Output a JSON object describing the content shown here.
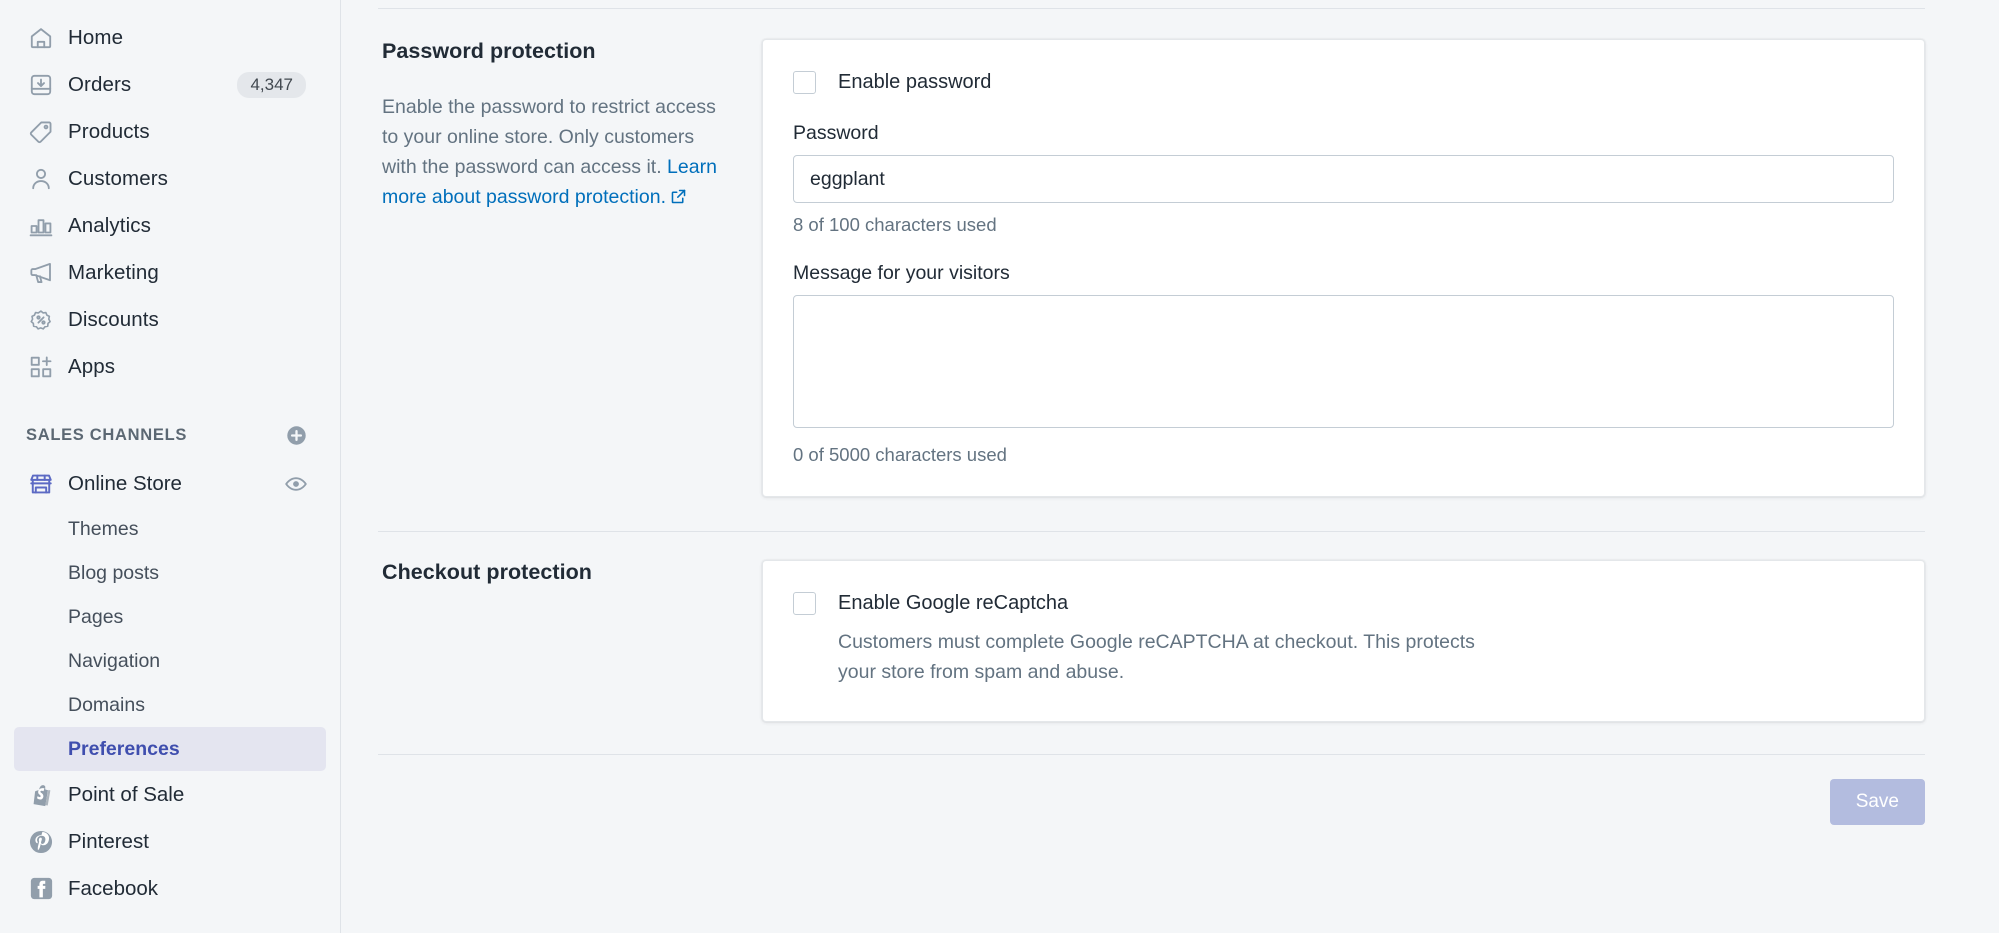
{
  "sidebar": {
    "nav": [
      {
        "label": "Home",
        "icon": "home-icon",
        "badge": null
      },
      {
        "label": "Orders",
        "icon": "orders-icon",
        "badge": "4,347"
      },
      {
        "label": "Products",
        "icon": "products-tag-icon",
        "badge": null
      },
      {
        "label": "Customers",
        "icon": "customers-person-icon",
        "badge": null
      },
      {
        "label": "Analytics",
        "icon": "analytics-bar-chart-icon",
        "badge": null
      },
      {
        "label": "Marketing",
        "icon": "marketing-megaphone-icon",
        "badge": null
      },
      {
        "label": "Discounts",
        "icon": "discounts-percent-icon",
        "badge": null
      },
      {
        "label": "Apps",
        "icon": "apps-grid-plus-icon",
        "badge": null
      }
    ],
    "sales_channels": {
      "title": "SALES CHANNELS",
      "add_icon": "plus-circle-icon",
      "online_store": {
        "label": "Online Store",
        "icon": "storefront-icon",
        "view_icon": "eye-icon"
      },
      "sub_items": [
        {
          "label": "Themes",
          "active": false
        },
        {
          "label": "Blog posts",
          "active": false
        },
        {
          "label": "Pages",
          "active": false
        },
        {
          "label": "Navigation",
          "active": false
        },
        {
          "label": "Domains",
          "active": false
        },
        {
          "label": "Preferences",
          "active": true
        }
      ],
      "channels": [
        {
          "label": "Point of Sale",
          "icon": "shopify-pos-icon"
        },
        {
          "label": "Pinterest",
          "icon": "pinterest-icon"
        },
        {
          "label": "Facebook",
          "icon": "facebook-icon"
        }
      ]
    }
  },
  "main": {
    "password_protection": {
      "heading": "Password protection",
      "description_prefix": "Enable the password to restrict access to your online store. Only customers with the password can access it. ",
      "link_text": "Learn more about password protection.",
      "enable_checkbox_label": "Enable password",
      "enable_checked": false,
      "password_field_label": "Password",
      "password_value": "eggplant",
      "password_counter": "8 of 100 characters used",
      "message_field_label": "Message for your visitors",
      "message_value": "",
      "message_counter": "0 of 5000 characters used"
    },
    "checkout_protection": {
      "heading": "Checkout protection",
      "enable_checkbox_label": "Enable Google reCaptcha",
      "enable_checked": false,
      "description": "Customers must complete Google reCAPTCHA at checkout. This protects your store from spam and abuse."
    },
    "save_label": "Save"
  },
  "colors": {
    "page_bg": "#f4f6f8",
    "card_bg": "#ffffff",
    "text": "#212b36",
    "muted_text": "#637381",
    "link": "#006fbb",
    "active_nav_bg": "#e4e5f0",
    "active_nav_text": "#3f4eae",
    "save_disabled_bg": "#b3bcdf",
    "divider": "#dfe3e8"
  }
}
